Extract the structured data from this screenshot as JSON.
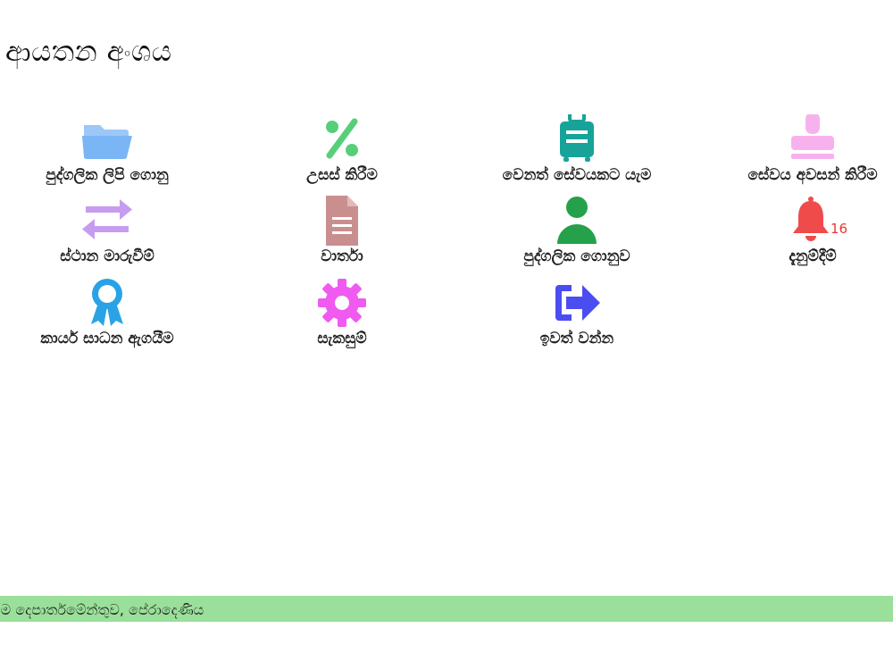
{
  "page_title": "ආයතන අංශය",
  "tiles": [
    {
      "label": "පුද්ගලික ලිපි ගොනු",
      "icon": "folder-icon",
      "color": "#7ab6f5"
    },
    {
      "label": "උසස් කිරීම",
      "icon": "percent-icon",
      "color": "#57cf7a"
    },
    {
      "label": "වෙනත් සේවයකට යැම",
      "icon": "suitcase-icon",
      "color": "#17a39a"
    },
    {
      "label": "සේවය අවසන් කිරීම",
      "icon": "stamp-icon",
      "color": "#f7b2ee"
    },
    {
      "label": "ස්ථාන මාරුවීම්",
      "icon": "exchange-icon",
      "color": "#c79cf0"
    },
    {
      "label": "වාර්තා",
      "icon": "document-icon",
      "color": "#c98f8f"
    },
    {
      "label": "පුද්ගලික ගොනුව",
      "icon": "user-icon",
      "color": "#24a14a"
    },
    {
      "label": "දැනුම්දීම්",
      "icon": "bell-icon",
      "color": "#f04b4b",
      "badge": "16"
    },
    {
      "label": "කාර්ය සාධන ඇගයීම",
      "icon": "award-icon",
      "color": "#2aa3e6"
    },
    {
      "label": "සැකසුම්",
      "icon": "gear-icon",
      "color": "#f05af0"
    },
    {
      "label": "ඉවත් වන්න",
      "icon": "sign-out-icon",
      "color": "#4a4ef0"
    }
  ],
  "footer": {
    "text": "ීම දෙපාර්තමේන්තුව, පේරාදෙණිය"
  }
}
